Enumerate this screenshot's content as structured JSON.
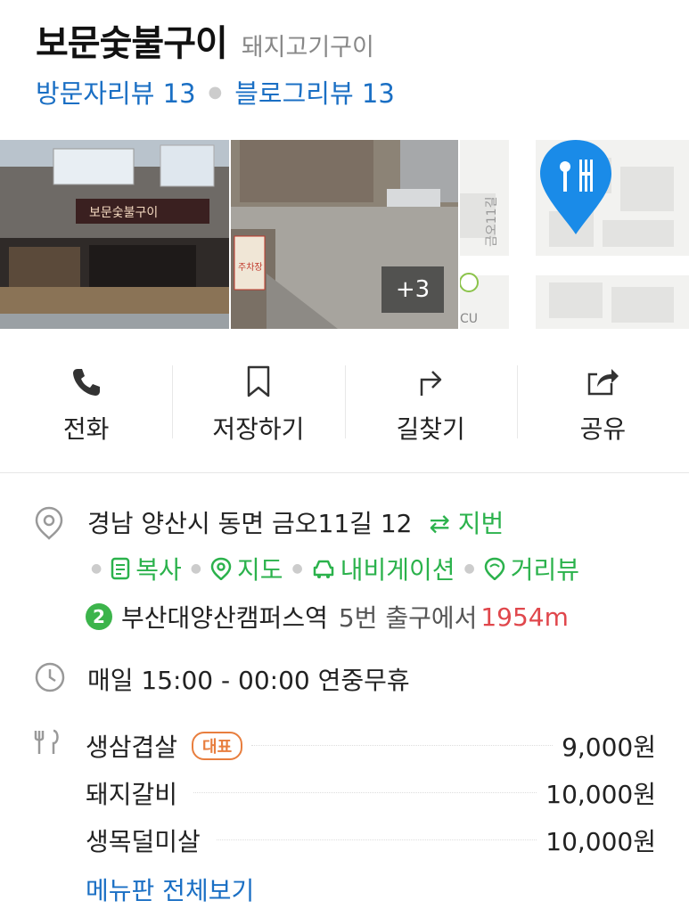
{
  "place": {
    "name": "보문숯불구이",
    "category": "돼지고기구이",
    "visitor_review": "방문자리뷰 13",
    "blog_review": "블로그리뷰 13"
  },
  "photos": {
    "more": "+3",
    "shop_sign": "보문숯불구이",
    "parking_sign": "주차장",
    "map_street": "금오11길",
    "map_poi": "CU"
  },
  "actions": [
    {
      "label": "전화",
      "icon": "phone-icon"
    },
    {
      "label": "저장하기",
      "icon": "bookmark-icon"
    },
    {
      "label": "길찾기",
      "icon": "directions-icon"
    },
    {
      "label": "공유",
      "icon": "share-icon"
    }
  ],
  "address": {
    "text": "경남 양산시 동면 금오11길 12",
    "jibun": "⇄ 지번",
    "copy": "복사",
    "map": "지도",
    "navigation": "내비게이션",
    "street_view": "거리뷰"
  },
  "station": {
    "line": "2",
    "name": "부산대양산캠퍼스역",
    "exit": "5번 출구에서",
    "distance": "1954m"
  },
  "hours": "매일 15:00 - 00:00 연중무휴",
  "menu": {
    "items": [
      {
        "name": "생삼겹살",
        "badge": "대표",
        "price": "9,000원"
      },
      {
        "name": "돼지갈비",
        "price": "10,000원"
      },
      {
        "name": "생목덜미살",
        "price": "10,000원"
      }
    ],
    "more": "메뉴판 전체보기"
  },
  "colors": {
    "link_blue": "#1a6fc4",
    "green": "#2bb24c",
    "distance_red": "#e0474c",
    "badge_orange": "#e87e3e",
    "map_pin": "#1a8be8"
  }
}
